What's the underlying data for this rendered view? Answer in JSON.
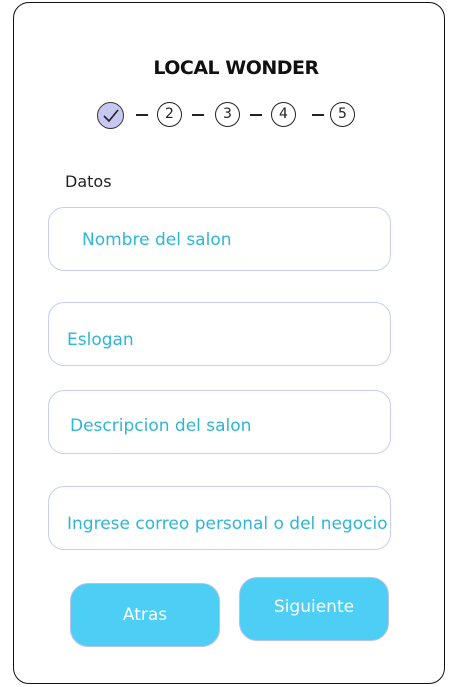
{
  "app": {
    "title": "LOCAL WONDER"
  },
  "stepper": {
    "steps": [
      "2",
      "3",
      "4",
      "5"
    ]
  },
  "form": {
    "section_label": "Datos",
    "fields": [
      {
        "placeholder": "Nombre del salon"
      },
      {
        "placeholder": "Eslogan"
      },
      {
        "placeholder": "Descripcion del  salon"
      },
      {
        "placeholder": "Ingrese correo personal o del negocio"
      }
    ]
  },
  "buttons": {
    "back_label": "Atras",
    "next_label": "Siguiente"
  },
  "colors": {
    "accent": "#4dcef4",
    "placeholder": "#2fb6d6",
    "field_border": "#c8cdf2",
    "completed_step": "#c6c8f0"
  },
  "icons": {
    "completed_step": "check-icon"
  }
}
